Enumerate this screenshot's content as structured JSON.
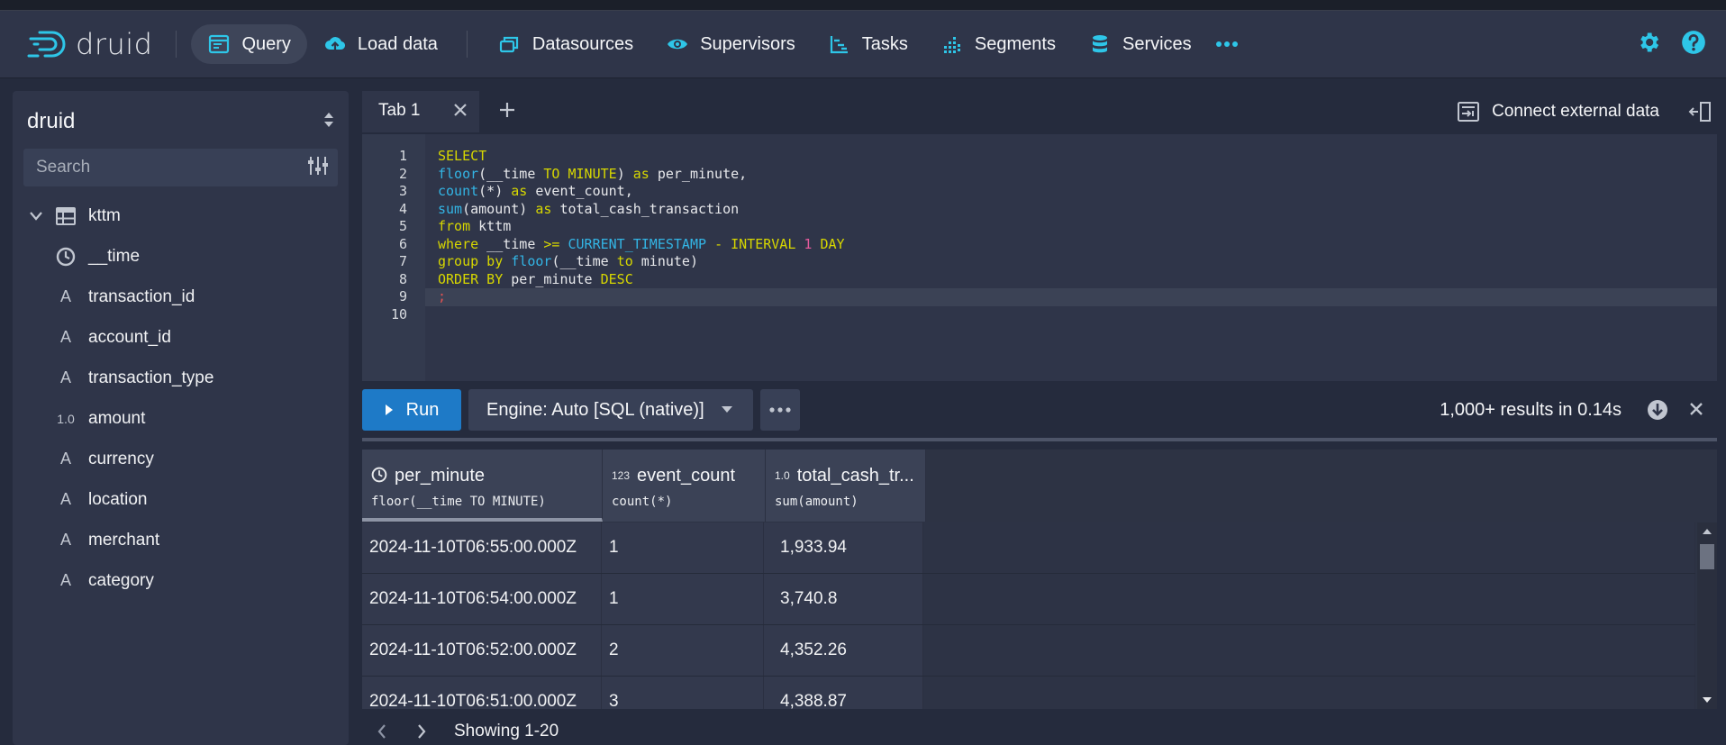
{
  "app": {
    "logo_text": "druid"
  },
  "nav": {
    "items": [
      {
        "label": "Query"
      },
      {
        "label": "Load data"
      },
      {
        "label": "Datasources"
      },
      {
        "label": "Supervisors"
      },
      {
        "label": "Tasks"
      },
      {
        "label": "Segments"
      },
      {
        "label": "Services"
      }
    ]
  },
  "sidebar": {
    "title": "druid",
    "search_placeholder": "Search",
    "table": "kttm",
    "columns": [
      {
        "name": "__time",
        "type_icon": "clock-icon"
      },
      {
        "name": "transaction_id",
        "type_icon": "string-icon"
      },
      {
        "name": "account_id",
        "type_icon": "string-icon"
      },
      {
        "name": "transaction_type",
        "type_icon": "string-icon"
      },
      {
        "name": "amount",
        "type_icon": "number-icon"
      },
      {
        "name": "currency",
        "type_icon": "string-icon"
      },
      {
        "name": "location",
        "type_icon": "string-icon"
      },
      {
        "name": "merchant",
        "type_icon": "string-icon"
      },
      {
        "name": "category",
        "type_icon": "string-icon"
      }
    ],
    "string_glyph": "A",
    "number_glyph": "1.0"
  },
  "tabs": {
    "tab1": "Tab 1",
    "connect_label": "Connect external data"
  },
  "editor": {
    "line_numbers": [
      "1",
      "2",
      "3",
      "4",
      "5",
      "6",
      "7",
      "8",
      "9",
      "10"
    ]
  },
  "toolbar": {
    "run_label": "Run",
    "engine_label": "Engine: Auto [SQL (native)]",
    "results_info": "1,000+ results in 0.14s"
  },
  "grid": {
    "columns": [
      {
        "name": "per_minute",
        "expr": "floor(__time TO MINUTE)",
        "type_glyph": ""
      },
      {
        "name": "event_count",
        "expr": "count(*)",
        "type_glyph": "123"
      },
      {
        "name": "total_cash_tr...",
        "expr": "sum(amount)",
        "type_glyph": "1.0"
      }
    ],
    "rows": [
      [
        "2024-11-10T06:55:00.000Z",
        "1",
        "1,933.94"
      ],
      [
        "2024-11-10T06:54:00.000Z",
        "1",
        "3,740.8"
      ],
      [
        "2024-11-10T06:52:00.000Z",
        "2",
        "4,352.26"
      ],
      [
        "2024-11-10T06:51:00.000Z",
        "3",
        "4,388.87"
      ]
    ]
  },
  "pager": {
    "info": "Showing 1-20"
  },
  "colors": {
    "accent": "#1e7ac7",
    "icon": "#2ec6e8",
    "navbar": "#2f3549",
    "background": "#252b3d"
  }
}
